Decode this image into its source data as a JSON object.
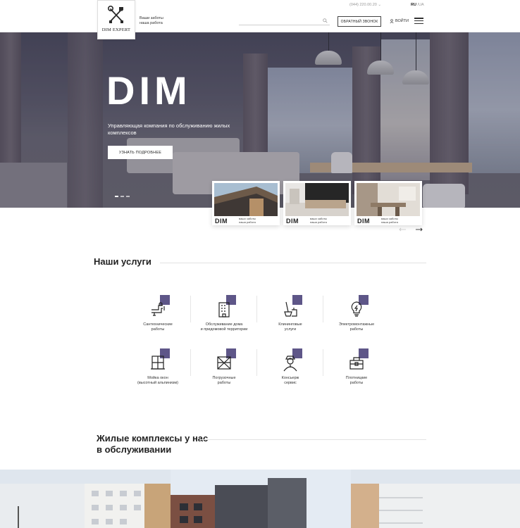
{
  "header": {
    "logo_text": "DIM EXPERT",
    "tagline_line1": "Ваши заботы",
    "tagline_line2": "наша работа",
    "phone": "(044) 220.00.20",
    "lang_active": "RU",
    "lang_other": "UA",
    "callback_label": "ОБРАТНЫЙ ЗВОНОК",
    "login_label": "ВОЙТИ",
    "search_placeholder": ""
  },
  "hero": {
    "title": "DIM",
    "subtitle": "Управляющая компания по обслуживанию жилых комплексов",
    "button_label": "УЗНАТЬ ПОДРОБНЕЕ"
  },
  "cards": [
    {
      "brand": "DIM",
      "tag_line1": "ваши заботы",
      "tag_line2": "наша работа"
    },
    {
      "brand": "DIM",
      "tag_line1": "ваши заботы",
      "tag_line2": "наша работа"
    },
    {
      "brand": "DIM",
      "tag_line1": "ваши заботы",
      "tag_line2": "наша работа"
    }
  ],
  "services": {
    "title": "Наши услуги",
    "items": [
      {
        "label_line1": "Сантехнические",
        "label_line2": "работы",
        "icon": "plumbing-icon"
      },
      {
        "label_line1": "Обслуживание дома",
        "label_line2": "и придомовой территории",
        "icon": "building-icon"
      },
      {
        "label_line1": "Клининговые",
        "label_line2": "услуги",
        "icon": "cleaning-icon"
      },
      {
        "label_line1": "Электромонтажные",
        "label_line2": "работы",
        "icon": "lightbulb-icon"
      },
      {
        "label_line1": "Мойка окон",
        "label_line2": "(высотный альпинизм)",
        "icon": "window-icon"
      },
      {
        "label_line1": "Погрузочные",
        "label_line2": "работы",
        "icon": "crate-icon"
      },
      {
        "label_line1": "Консьерж",
        "label_line2": "сервис",
        "icon": "concierge-icon"
      },
      {
        "label_line1": "Плотницкие",
        "label_line2": "работы",
        "icon": "toolbox-icon"
      }
    ]
  },
  "complexes": {
    "title_line1": "Жилые комплексы у нас",
    "title_line2": "в обслуживании"
  },
  "colors": {
    "accent": "#5e5688",
    "hero_tint": "#4b4a5d"
  }
}
